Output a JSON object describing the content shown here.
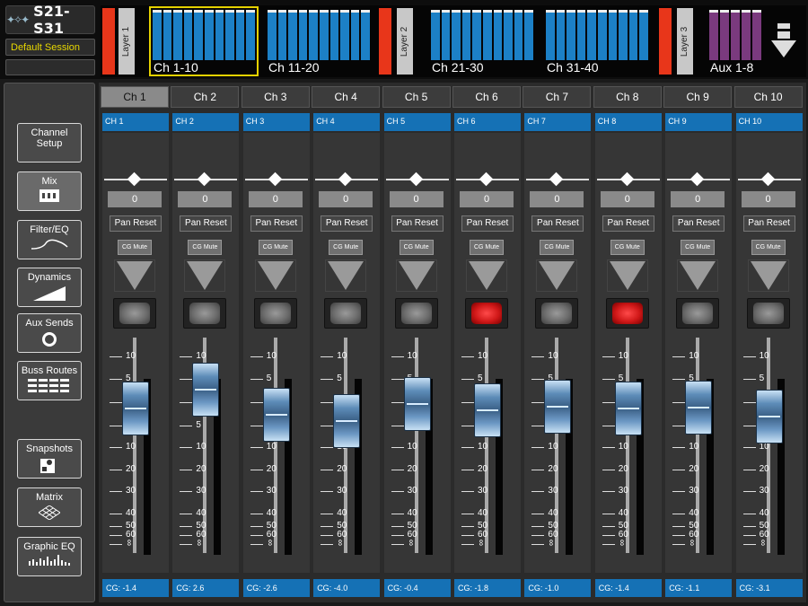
{
  "app": {
    "model": "S21-S31",
    "session": "Default Session"
  },
  "overview": {
    "layers": [
      "Layer 1",
      "Layer 2",
      "Layer 3"
    ],
    "banks": [
      "Ch 1-10",
      "Ch 11-20",
      "Ch 21-30",
      "Ch 31-40",
      "Aux 1-8"
    ]
  },
  "nav": {
    "channel_setup": "Channel Setup",
    "mix": "Mix",
    "filter_eq": "Filter/EQ",
    "dynamics": "Dynamics",
    "aux_sends": "Aux Sends",
    "buss_routes": "Buss Routes",
    "snapshots": "Snapshots",
    "matrix": "Matrix",
    "graphic_eq": "Graphic EQ"
  },
  "strip_common": {
    "pan_reset": "Pan Reset",
    "cg_mute": "CG Mute"
  },
  "scale": [
    "10",
    "5",
    "0",
    "5",
    "10",
    "20",
    "30",
    "40",
    "50",
    "60",
    "∞"
  ],
  "channels": [
    {
      "tab": "Ch 1",
      "name": "CH 1",
      "pan": "0",
      "cg": "CG: -1.4",
      "mute_on": false,
      "fader_db": -1.4
    },
    {
      "tab": "Ch 2",
      "name": "CH 2",
      "pan": "0",
      "cg": "CG: 2.6",
      "mute_on": false,
      "fader_db": 2.6
    },
    {
      "tab": "Ch 3",
      "name": "CH 3",
      "pan": "0",
      "cg": "CG: -2.6",
      "mute_on": false,
      "fader_db": -2.6
    },
    {
      "tab": "Ch 4",
      "name": "CH 4",
      "pan": "0",
      "cg": "CG: -4.0",
      "mute_on": false,
      "fader_db": -4.0
    },
    {
      "tab": "Ch 5",
      "name": "CH 5",
      "pan": "0",
      "cg": "CG: -0.4",
      "mute_on": false,
      "fader_db": -0.4
    },
    {
      "tab": "Ch 6",
      "name": "CH 6",
      "pan": "0",
      "cg": "CG: -1.8",
      "mute_on": true,
      "fader_db": -1.8
    },
    {
      "tab": "Ch 7",
      "name": "CH 7",
      "pan": "0",
      "cg": "CG: -1.0",
      "mute_on": false,
      "fader_db": -1.0
    },
    {
      "tab": "Ch 8",
      "name": "CH 8",
      "pan": "0",
      "cg": "CG: -1.4",
      "mute_on": true,
      "fader_db": -1.4
    },
    {
      "tab": "Ch 9",
      "name": "CH 9",
      "pan": "0",
      "cg": "CG: -1.1",
      "mute_on": false,
      "fader_db": -1.1
    },
    {
      "tab": "Ch 10",
      "name": "CH 10",
      "pan": "0",
      "cg": "CG: -3.1",
      "mute_on": false,
      "fader_db": -3.1
    }
  ],
  "colors": {
    "accent_blue": "#1571b5",
    "mute_red": "#d01818",
    "layer_red": "#e8361a",
    "selection": "#e6d200"
  }
}
